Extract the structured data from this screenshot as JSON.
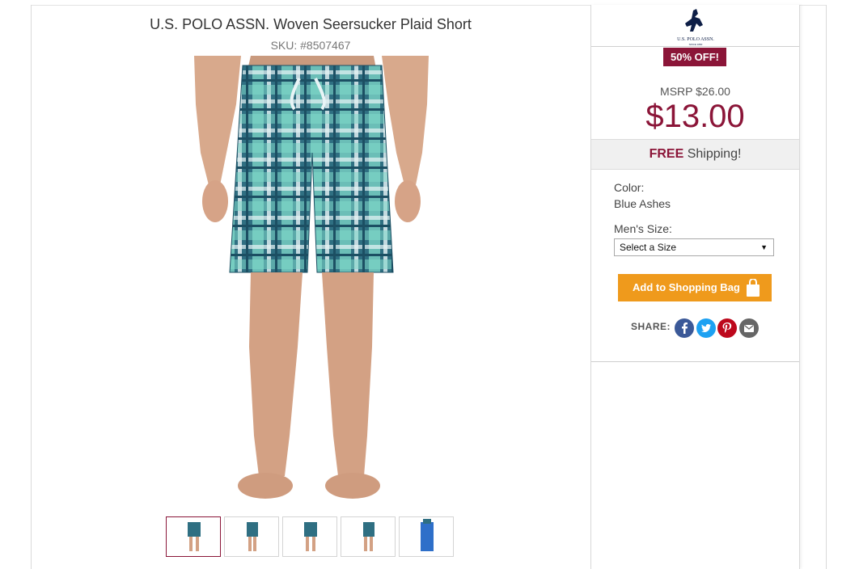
{
  "product": {
    "title": "U.S. POLO ASSN. Woven Seersucker Plaid Short",
    "sku": "SKU: #8507467"
  },
  "brand": {
    "logo_text": "U.S. POLO ASSN.",
    "logo_subtext": "SINCE 1890"
  },
  "pricing": {
    "discount_badge": "50% OFF!",
    "msrp": "MSRP $26.00",
    "price": "$13.00"
  },
  "shipping": {
    "free_label": "FREE",
    "rest": " Shipping!"
  },
  "options": {
    "color_label": "Color:",
    "color_value": "Blue Ashes",
    "size_label": "Men's Size:",
    "size_selected": "Select a Size"
  },
  "actions": {
    "add_to_bag": "Add to Shopping Bag",
    "share_label": "SHARE:"
  },
  "social_icons": [
    "facebook-icon",
    "twitter-icon",
    "pinterest-icon",
    "email-icon"
  ],
  "colors": {
    "accent": "#8b1538",
    "button": "#ef9a1c",
    "facebook": "#3b5998",
    "twitter": "#1da1f2",
    "pinterest": "#bd081c",
    "email": "#666666"
  },
  "thumbnails": {
    "active_index": 0,
    "count": 5
  }
}
